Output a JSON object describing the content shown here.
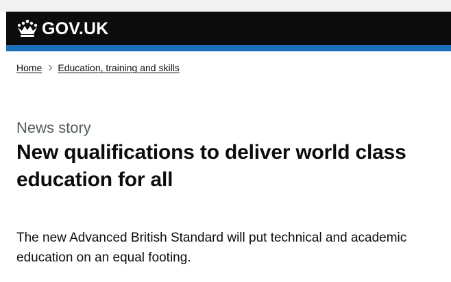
{
  "header": {
    "logo_text": "GOV.UK",
    "logo_icon": "crown-icon",
    "background_color": "#0b0c0c",
    "accent_color": "#1d70b8"
  },
  "breadcrumb": {
    "items": [
      {
        "label": "Home"
      },
      {
        "label": "Education, training and skills"
      }
    ],
    "separator_icon": "chevron-right-icon"
  },
  "article": {
    "type_label": "News story",
    "title": "New qualifications to deliver world class education for all",
    "summary": "The new Advanced British Standard will put technical and academic education on an equal footing."
  }
}
